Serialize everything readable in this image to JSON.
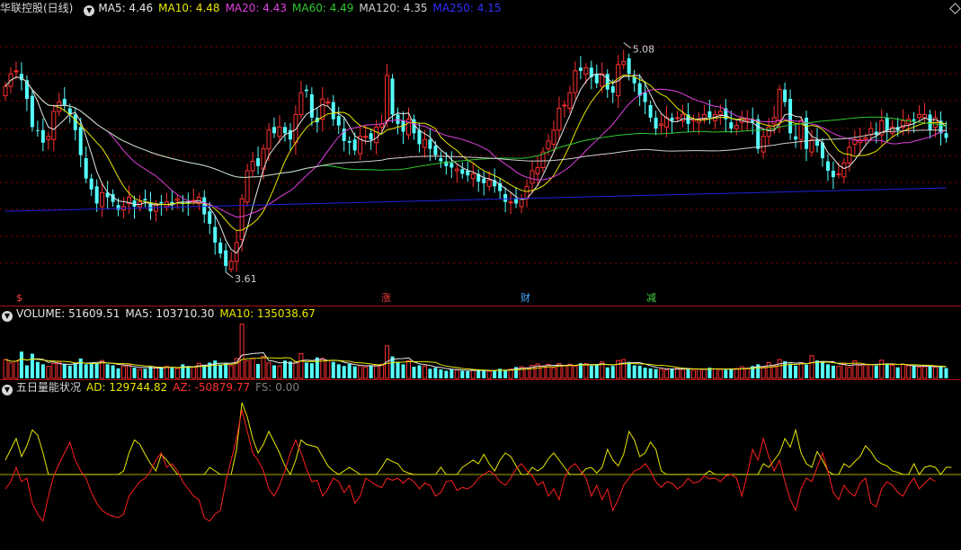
{
  "main_header": {
    "stock": "华联控股(日线)",
    "ma5": "MA5: 4.46",
    "ma10": "MA10: 4.48",
    "ma20": "MA20: 4.43",
    "ma60": "MA60: 4.49",
    "ma120": "MA120: 4.35",
    "ma250": "MA250: 4.15"
  },
  "volume_header": {
    "label": "VOLUME: 51609.51",
    "ma5": "MA5: 103710.30",
    "ma10": "MA10: 135038.67"
  },
  "indicator_header": {
    "name": "五日量能状况",
    "ad": "AD: 129744.82",
    "az": "AZ: -50879.77",
    "fs": "FS: 0.00"
  },
  "annotations": {
    "high": "5.08",
    "low": "3.61"
  },
  "markers": [
    {
      "label": "$",
      "color": "#ff4040"
    },
    {
      "label": "涨",
      "color": "#ff4040"
    },
    {
      "label": "财",
      "color": "#4aa8ff"
    },
    {
      "label": "减",
      "color": "#40d040"
    }
  ],
  "colors": {
    "up": "#ff3030",
    "down": "#54ffff",
    "ma5": "#e8e8e8",
    "ma10": "#e8e800",
    "ma20": "#e040e0",
    "ma60": "#30c830",
    "ma120": "#d0d0d0",
    "ma250": "#2020e0",
    "grid": "#8b0000"
  },
  "chart_data": [
    {
      "type": "candlestick",
      "title": "华联控股(日线)",
      "ylim": [
        3.5,
        5.25
      ],
      "high": 5.08,
      "low": 3.61,
      "x": [
        0,
        1,
        2,
        3,
        4,
        5,
        6,
        7,
        8,
        9,
        10,
        11,
        12,
        13,
        14,
        15,
        16,
        17,
        18,
        19,
        20,
        21,
        22,
        23,
        24,
        25,
        26,
        27,
        28,
        29,
        30,
        31,
        32,
        33,
        34,
        35,
        36,
        37,
        38,
        39,
        40,
        41,
        42,
        43,
        44,
        45,
        46,
        47,
        48,
        49,
        50,
        51,
        52,
        53,
        54,
        55,
        56,
        57,
        58,
        59,
        60,
        61,
        62,
        63,
        64,
        65,
        66,
        67,
        68,
        69,
        70,
        71,
        72,
        73,
        74,
        75,
        76,
        77,
        78,
        79,
        80,
        81,
        82,
        83,
        84,
        85,
        86,
        87,
        88,
        89,
        90,
        91,
        92,
        93,
        94,
        95,
        96,
        97,
        98,
        99,
        100,
        101,
        102,
        103,
        104,
        105,
        106,
        107,
        108,
        109,
        110,
        111,
        112,
        113,
        114,
        115,
        116,
        117,
        118,
        119,
        120,
        121,
        122,
        123,
        124,
        125,
        126,
        127,
        128,
        129,
        130,
        131,
        132,
        133,
        134,
        135,
        136,
        137,
        138,
        139,
        140,
        141,
        142,
        143,
        144,
        145,
        146,
        147,
        148,
        149,
        150,
        151,
        152,
        153,
        154,
        155,
        156,
        157,
        158,
        159,
        160,
        161,
        162,
        163,
        164,
        165,
        166,
        167,
        168,
        169,
        170,
        171,
        172,
        173,
        174,
        175,
        176,
        177
      ],
      "close": [
        4.8,
        4.88,
        4.9,
        4.84,
        4.72,
        4.54,
        4.52,
        4.44,
        4.48,
        4.64,
        4.7,
        4.68,
        4.62,
        4.52,
        4.36,
        4.21,
        4.14,
        4.05,
        4.12,
        4.09,
        4.06,
        4.01,
        4.03,
        4.09,
        4.03,
        4.06,
        4.07,
        4.0,
        4.04,
        4.05,
        4.06,
        4.05,
        4.08,
        4.06,
        4.05,
        4.07,
        4.09,
        3.98,
        3.92,
        3.8,
        3.73,
        3.65,
        3.68,
        3.8,
        4.08,
        4.26,
        4.32,
        4.29,
        4.4,
        4.52,
        4.5,
        4.54,
        4.5,
        4.46,
        4.62,
        4.76,
        4.77,
        4.6,
        4.57,
        4.72,
        4.7,
        4.59,
        4.55,
        4.45,
        4.44,
        4.39,
        4.48,
        4.48,
        4.46,
        4.54,
        4.56,
        4.87,
        4.62,
        4.56,
        4.51,
        4.59,
        4.5,
        4.43,
        4.46,
        4.4,
        4.36,
        4.32,
        4.29,
        4.28,
        4.27,
        4.24,
        4.23,
        4.24,
        4.19,
        4.18,
        4.2,
        4.16,
        4.13,
        4.06,
        4.06,
        4.05,
        4.08,
        4.16,
        4.26,
        4.28,
        4.38,
        4.45,
        4.52,
        4.66,
        4.68,
        4.76,
        4.9,
        4.9,
        4.92,
        4.86,
        4.82,
        4.88,
        4.78,
        4.76,
        4.94,
        4.96,
        4.88,
        4.82,
        4.74,
        4.7,
        4.6,
        4.53,
        4.56,
        4.6,
        4.58,
        4.6,
        4.62,
        4.56,
        4.59,
        4.59,
        4.62,
        4.6,
        4.62,
        4.64,
        4.59,
        4.53,
        4.55,
        4.6,
        4.59,
        4.57,
        4.4,
        4.48,
        4.54,
        4.6,
        4.78,
        4.7,
        4.5,
        4.46,
        4.58,
        4.4,
        4.46,
        4.42,
        4.34,
        4.26,
        4.22,
        4.24,
        4.31,
        4.41,
        4.46,
        4.46,
        4.47,
        4.53,
        4.49,
        4.58,
        4.52,
        4.54,
        4.52,
        4.58,
        4.59,
        4.58,
        4.62,
        4.62,
        4.52,
        4.6,
        4.5,
        4.47
      ]
    },
    {
      "type": "bar",
      "title": "VOLUME",
      "values": [
        0.55,
        0.45,
        0.5,
        0.78,
        0.38,
        0.72,
        0.48,
        0.41,
        0.35,
        0.43,
        0.47,
        0.42,
        0.37,
        0.44,
        0.58,
        0.41,
        0.46,
        0.43,
        0.52,
        0.41,
        0.38,
        0.29,
        0.36,
        0.39,
        0.31,
        0.26,
        0.28,
        0.34,
        0.32,
        0.31,
        0.35,
        0.3,
        0.29,
        0.41,
        0.36,
        0.33,
        0.44,
        0.38,
        0.46,
        0.52,
        0.41,
        0.45,
        0.37,
        0.58,
        1.58,
        0.51,
        0.58,
        0.42,
        0.64,
        0.45,
        0.38,
        0.36,
        0.52,
        0.49,
        0.48,
        0.72,
        0.46,
        0.44,
        0.61,
        0.58,
        0.52,
        0.48,
        0.41,
        0.36,
        0.42,
        0.35,
        0.37,
        0.33,
        0.38,
        0.39,
        0.41,
        0.95,
        0.64,
        0.48,
        0.41,
        0.52,
        0.34,
        0.38,
        0.36,
        0.28,
        0.31,
        0.26,
        0.22,
        0.27,
        0.24,
        0.22,
        0.21,
        0.24,
        0.25,
        0.22,
        0.21,
        0.23,
        0.28,
        0.25,
        0.27,
        0.33,
        0.34,
        0.31,
        0.38,
        0.42,
        0.36,
        0.41,
        0.31,
        0.43,
        0.38,
        0.41,
        0.36,
        0.44,
        0.43,
        0.37,
        0.41,
        0.48,
        0.32,
        0.36,
        0.52,
        0.55,
        0.48,
        0.38,
        0.37,
        0.31,
        0.29,
        0.27,
        0.26,
        0.25,
        0.28,
        0.31,
        0.26,
        0.29,
        0.24,
        0.27,
        0.26,
        0.31,
        0.28,
        0.26,
        0.25,
        0.27,
        0.29,
        0.34,
        0.3,
        0.36,
        0.41,
        0.33,
        0.46,
        0.37,
        0.55,
        0.5,
        0.43,
        0.37,
        0.44,
        0.4,
        0.66,
        0.52,
        0.46,
        0.41,
        0.37,
        0.35,
        0.43,
        0.32,
        0.51,
        0.38,
        0.39,
        0.4,
        0.37,
        0.53,
        0.43,
        0.38,
        0.32,
        0.41,
        0.37,
        0.36,
        0.33,
        0.34,
        0.36,
        0.33,
        0.36,
        0.3
      ]
    },
    {
      "type": "line",
      "title": "五日量能状况",
      "series": [
        {
          "name": "AD",
          "color": "#e8e800",
          "values": [
            0.2,
            0.35,
            0.5,
            0.25,
            0.4,
            0.62,
            0.55,
            0.3,
            0,
            0,
            0,
            0,
            0,
            0,
            0,
            0,
            0,
            0,
            0,
            0,
            0,
            0,
            0.05,
            0.3,
            0.48,
            0.42,
            0.28,
            0.15,
            0.05,
            0.28,
            0.2,
            0.1,
            0,
            0,
            0,
            0,
            0,
            0,
            0.1,
            0.05,
            0,
            0,
            0,
            0.35,
            1.0,
            0.8,
            0.5,
            0.3,
            0.42,
            0.6,
            0.45,
            0.3,
            0.12,
            0,
            0.2,
            0.48,
            0.42,
            0.4,
            0.38,
            0.25,
            0.12,
            0.05,
            0,
            0.05,
            0.1,
            0.05,
            0,
            0,
            0,
            0,
            0.1,
            0.22,
            0.18,
            0.15,
            0.05,
            0.02,
            0,
            0,
            0,
            0,
            0,
            0.1,
            0,
            0,
            0,
            0.1,
            0.15,
            0.2,
            0.15,
            0.28,
            0.15,
            0.05,
            0.2,
            0.3,
            0.25,
            0.12,
            0,
            0,
            0.1,
            0.05,
            0.1,
            0.22,
            0.3,
            0.2,
            0.1,
            0,
            0,
            0,
            0.08,
            0.1,
            0.02,
            0.1,
            0.35,
            0.2,
            0.12,
            0.28,
            0.6,
            0.48,
            0.25,
            0.3,
            0.45,
            0.35,
            0.05,
            0,
            0,
            0,
            0,
            0,
            0,
            0,
            0,
            0.05,
            0,
            0,
            0,
            0,
            0,
            0,
            0,
            0,
            0,
            0.15,
            0.1,
            0.2,
            0.3,
            0.5,
            0.38,
            0.62,
            0.3,
            0.15,
            0.1,
            0.32,
            0.2,
            0.05,
            0,
            0,
            0.15,
            0.1,
            0.18,
            0.25,
            0.4,
            0.32,
            0.2,
            0.15,
            0.12,
            0.05,
            0.03,
            0,
            0,
            0.15,
            0,
            0.1,
            0.12,
            0.1,
            0,
            0.1,
            0.1
          ]
        },
        {
          "name": "AZ",
          "color": "#ff2020",
          "values": [
            -0.2,
            -0.1,
            0.1,
            -0.1,
            -0.05,
            -0.4,
            -0.55,
            -0.65,
            -0.3,
            -0.02,
            0.15,
            0.3,
            0.45,
            0.2,
            0.05,
            -0.05,
            -0.25,
            -0.4,
            -0.5,
            -0.55,
            -0.58,
            -0.6,
            -0.55,
            -0.3,
            -0.2,
            -0.1,
            -0.05,
            0.05,
            0.2,
            0.3,
            0.1,
            0.15,
            0.05,
            -0.1,
            -0.2,
            -0.3,
            -0.35,
            -0.6,
            -0.65,
            -0.55,
            -0.5,
            -0.1,
            0.2,
            0.5,
            0.9,
            0.6,
            0.3,
            0.2,
            0.05,
            -0.2,
            -0.3,
            -0.15,
            0.05,
            0.3,
            0.48,
            0.3,
            0.08,
            -0.1,
            -0.08,
            -0.3,
            -0.2,
            -0.05,
            -0.1,
            -0.25,
            -0.15,
            -0.4,
            -0.3,
            -0.05,
            -0.1,
            -0.15,
            -0.18,
            -0.05,
            -0.08,
            -0.05,
            -0.12,
            -0.05,
            -0.1,
            -0.2,
            -0.12,
            -0.15,
            -0.3,
            -0.25,
            -0.1,
            -0.08,
            -0.22,
            -0.18,
            -0.2,
            -0.15,
            -0.05,
            0,
            0.05,
            0,
            -0.1,
            -0.15,
            -0.05,
            0.08,
            0.15,
            0.05,
            -0.02,
            -0.15,
            -0.1,
            -0.3,
            -0.2,
            -0.35,
            -0.05,
            0.1,
            0.15,
            0.05,
            -0.05,
            -0.3,
            -0.15,
            -0.35,
            -0.2,
            -0.5,
            -0.35,
            -0.15,
            -0.05,
            0.05,
            0.08,
            0.15,
            0.05,
            -0.1,
            -0.18,
            -0.1,
            -0.12,
            -0.2,
            -0.15,
            -0.05,
            -0.12,
            -0.1,
            -0.02,
            -0.06,
            -0.05,
            -0.1,
            -0.02,
            0,
            -0.05,
            -0.3,
            0,
            0.35,
            0.2,
            0.5,
            0.25,
            0.05,
            0.2,
            -0.1,
            -0.35,
            -0.5,
            -0.2,
            -0.05,
            -0.1,
            0.1,
            0.3,
            0.05,
            -0.25,
            -0.35,
            -0.15,
            -0.25,
            -0.3,
            -0.12,
            -0.05,
            -0.4,
            -0.45,
            -0.2,
            -0.1,
            -0.15,
            -0.25,
            -0.3,
            -0.15,
            -0.05,
            -0.2,
            -0.12,
            -0.05,
            -0.1
          ]
        }
      ]
    }
  ]
}
